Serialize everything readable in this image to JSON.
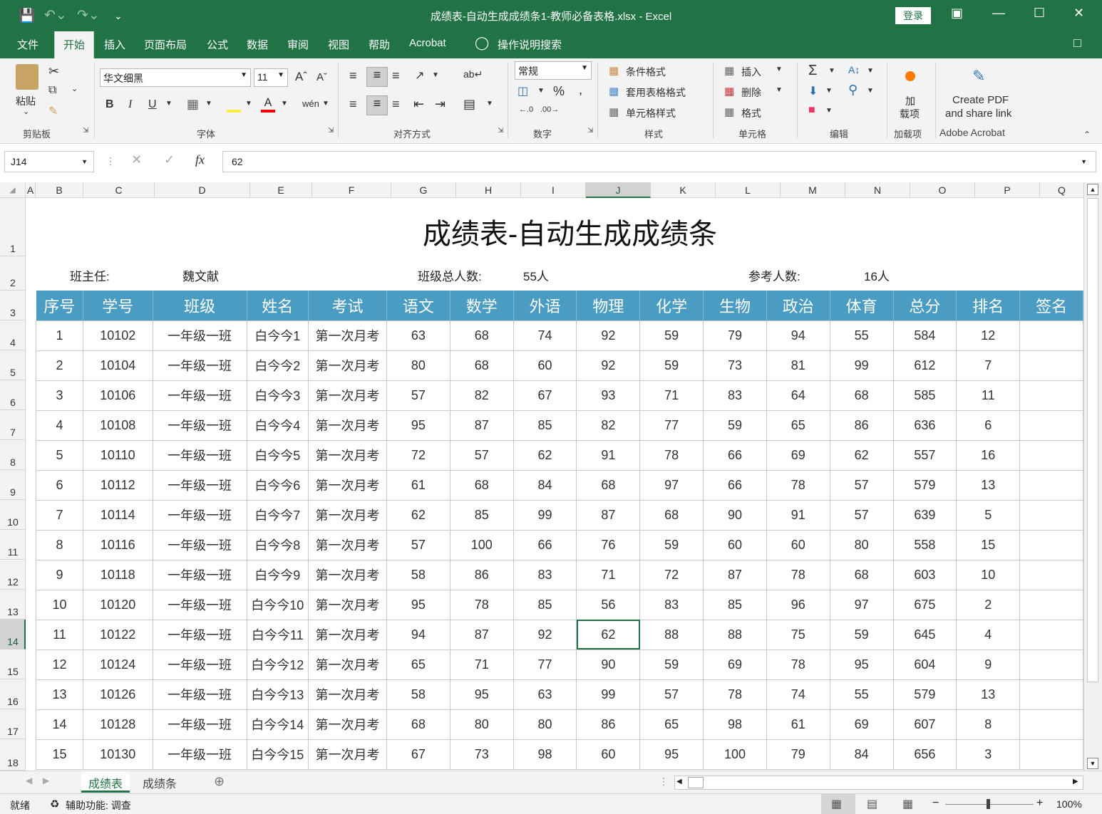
{
  "window": {
    "title": "成绩表-自动生成成绩条1-教师必备表格.xlsx  -  Excel",
    "login": "登录"
  },
  "menu": [
    "文件",
    "开始",
    "插入",
    "页面布局",
    "公式",
    "数据",
    "审阅",
    "视图",
    "帮助",
    "Acrobat"
  ],
  "menu_search": "操作说明搜索",
  "ribbon": {
    "clipboard": {
      "paste": "粘贴",
      "group": "剪贴板"
    },
    "font": {
      "name": "华文细黑",
      "size": "11",
      "group": "字体"
    },
    "align": {
      "group": "对齐方式"
    },
    "number": {
      "format": "常规",
      "group": "数字"
    },
    "styles": {
      "cond": "条件格式",
      "table": "套用表格格式",
      "cell": "单元格样式",
      "group": "样式"
    },
    "cells": {
      "insert": "插入",
      "delete": "删除",
      "format": "格式",
      "group": "单元格"
    },
    "edit": {
      "group": "编辑"
    },
    "addin": {
      "label1": "加",
      "label2": "载项",
      "group": "加载项"
    },
    "acrobat": {
      "line1": "Create PDF",
      "line2": "and share link",
      "group": "Adobe Acrobat"
    }
  },
  "formula_bar": {
    "name_box": "J14",
    "value": "62",
    "fx": "fx"
  },
  "columns": [
    "A",
    "B",
    "C",
    "D",
    "E",
    "F",
    "G",
    "H",
    "I",
    "J",
    "K",
    "L",
    "M",
    "N",
    "O",
    "P",
    "Q"
  ],
  "rows": [
    "1",
    "2",
    "3",
    "4",
    "5",
    "6",
    "7",
    "8",
    "9",
    "10",
    "11",
    "12",
    "13",
    "14",
    "15",
    "16",
    "17",
    "18"
  ],
  "sheet": {
    "title": "成绩表-自动生成成绩条",
    "teacher_label": "班主任:",
    "teacher": "魏文献",
    "total_label": "班级总人数:",
    "total": "55人",
    "exam_label": "参考人数:",
    "exam_count": "16人",
    "headers": [
      "序号",
      "学号",
      "班级",
      "姓名",
      "考试",
      "语文",
      "数学",
      "外语",
      "物理",
      "化学",
      "生物",
      "政治",
      "体育",
      "总分",
      "排名",
      "签名"
    ],
    "data": [
      [
        "1",
        "10102",
        "一年级一班",
        "白今今1",
        "第一次月考",
        "63",
        "68",
        "74",
        "92",
        "59",
        "79",
        "94",
        "55",
        "584",
        "12",
        ""
      ],
      [
        "2",
        "10104",
        "一年级一班",
        "白今今2",
        "第一次月考",
        "80",
        "68",
        "60",
        "92",
        "59",
        "73",
        "81",
        "99",
        "612",
        "7",
        ""
      ],
      [
        "3",
        "10106",
        "一年级一班",
        "白今今3",
        "第一次月考",
        "57",
        "82",
        "67",
        "93",
        "71",
        "83",
        "64",
        "68",
        "585",
        "11",
        ""
      ],
      [
        "4",
        "10108",
        "一年级一班",
        "白今今4",
        "第一次月考",
        "95",
        "87",
        "85",
        "82",
        "77",
        "59",
        "65",
        "86",
        "636",
        "6",
        ""
      ],
      [
        "5",
        "10110",
        "一年级一班",
        "白今今5",
        "第一次月考",
        "72",
        "57",
        "62",
        "91",
        "78",
        "66",
        "69",
        "62",
        "557",
        "16",
        ""
      ],
      [
        "6",
        "10112",
        "一年级一班",
        "白今今6",
        "第一次月考",
        "61",
        "68",
        "84",
        "68",
        "97",
        "66",
        "78",
        "57",
        "579",
        "13",
        ""
      ],
      [
        "7",
        "10114",
        "一年级一班",
        "白今今7",
        "第一次月考",
        "62",
        "85",
        "99",
        "87",
        "68",
        "90",
        "91",
        "57",
        "639",
        "5",
        ""
      ],
      [
        "8",
        "10116",
        "一年级一班",
        "白今今8",
        "第一次月考",
        "57",
        "100",
        "66",
        "76",
        "59",
        "60",
        "60",
        "80",
        "558",
        "15",
        ""
      ],
      [
        "9",
        "10118",
        "一年级一班",
        "白今今9",
        "第一次月考",
        "58",
        "86",
        "83",
        "71",
        "72",
        "87",
        "78",
        "68",
        "603",
        "10",
        ""
      ],
      [
        "10",
        "10120",
        "一年级一班",
        "白今今10",
        "第一次月考",
        "95",
        "78",
        "85",
        "56",
        "83",
        "85",
        "96",
        "97",
        "675",
        "2",
        ""
      ],
      [
        "11",
        "10122",
        "一年级一班",
        "白今今11",
        "第一次月考",
        "94",
        "87",
        "92",
        "62",
        "88",
        "88",
        "75",
        "59",
        "645",
        "4",
        ""
      ],
      [
        "12",
        "10124",
        "一年级一班",
        "白今今12",
        "第一次月考",
        "65",
        "71",
        "77",
        "90",
        "59",
        "69",
        "78",
        "95",
        "604",
        "9",
        ""
      ],
      [
        "13",
        "10126",
        "一年级一班",
        "白今今13",
        "第一次月考",
        "58",
        "95",
        "63",
        "99",
        "57",
        "78",
        "74",
        "55",
        "579",
        "13",
        ""
      ],
      [
        "14",
        "10128",
        "一年级一班",
        "白今今14",
        "第一次月考",
        "68",
        "80",
        "80",
        "86",
        "65",
        "98",
        "61",
        "69",
        "607",
        "8",
        ""
      ],
      [
        "15",
        "10130",
        "一年级一班",
        "白今今15",
        "第一次月考",
        "67",
        "73",
        "98",
        "60",
        "95",
        "100",
        "79",
        "84",
        "656",
        "3",
        ""
      ]
    ]
  },
  "tabs": [
    "成绩表",
    "成绩条"
  ],
  "status": {
    "ready": "就绪",
    "accessibility": "辅助功能: 调查",
    "zoom": "100%"
  }
}
